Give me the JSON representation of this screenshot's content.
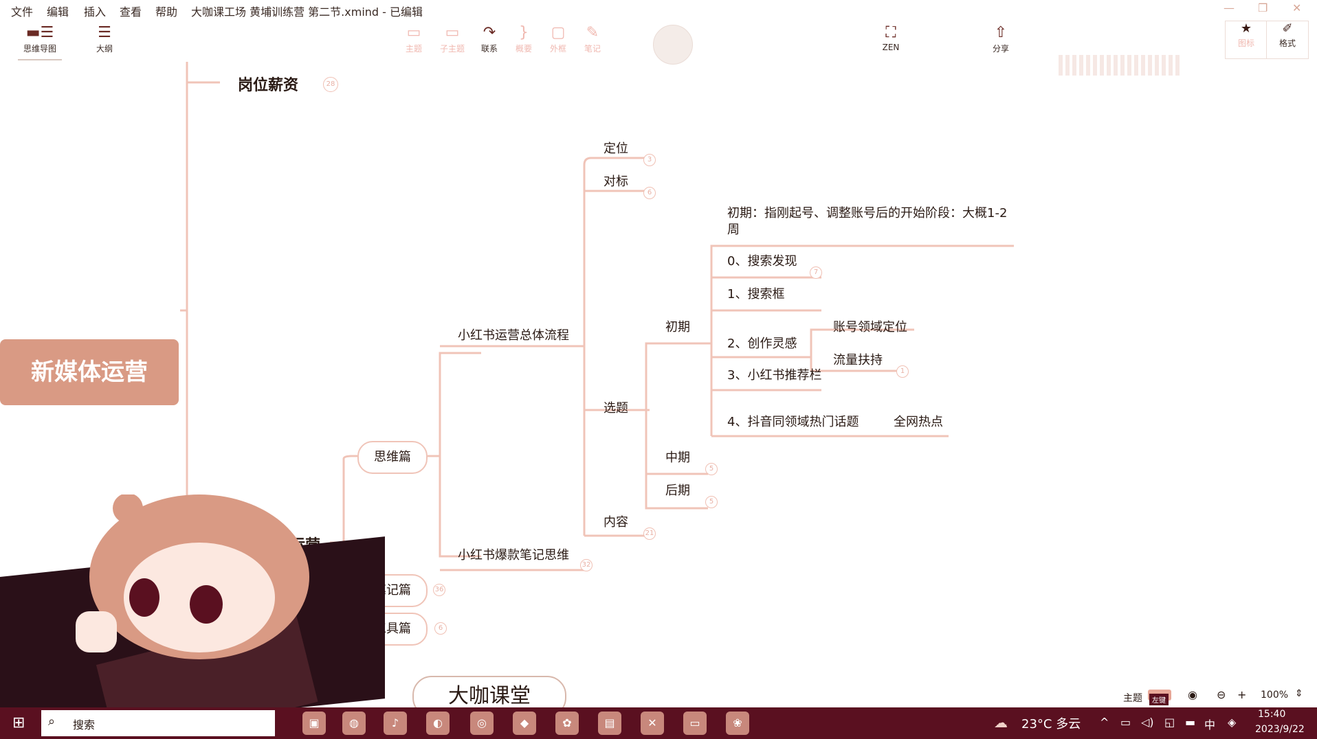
{
  "menubar": {
    "items": [
      "文件",
      "编辑",
      "插入",
      "查看",
      "帮助"
    ],
    "title": "大咖课工场 黄埔训练营 第二节.xmind - 已编辑"
  },
  "toolbar": {
    "mindmap": "思维导图",
    "outline": "大纲",
    "topic": "主题",
    "subtopic": "子主题",
    "relation": "联系",
    "summary": "概要",
    "boundary": "外框",
    "note": "笔记",
    "zen": "ZEN",
    "share": "分享",
    "icon_btn": "图标",
    "format": "格式"
  },
  "mindmap": {
    "root": "新媒体运营",
    "top_branch": "岗位薪资",
    "top_branch_count": "28",
    "partial_branch": "书运营",
    "l2": [
      {
        "label": "思维篇"
      },
      {
        "label": "笔记篇",
        "count": "36"
      },
      {
        "label": "工具篇",
        "count": "6"
      }
    ],
    "l3": [
      {
        "label": "小红书运营总体流程"
      },
      {
        "label": "小红书爆款笔记思维",
        "count": "32"
      }
    ],
    "l4": [
      {
        "label": "定位",
        "count": "3"
      },
      {
        "label": "对标",
        "count": "6"
      },
      {
        "label": "选题"
      },
      {
        "label": "内容",
        "count": "21"
      }
    ],
    "l5": [
      {
        "label": "初期"
      },
      {
        "label": "中期",
        "count": "5"
      },
      {
        "label": "后期",
        "count": "5"
      }
    ],
    "note_line1": "初期：指刚起号、调整账号后的开始阶段：大概1-2",
    "note_line2": "周",
    "l6": [
      {
        "label": "0、搜索发现",
        "count": "7"
      },
      {
        "label": "1、搜索框"
      },
      {
        "label": "2、创作灵感"
      },
      {
        "label": "3、小红书推荐栏"
      },
      {
        "label": "4、抖音同领域热门话题"
      }
    ],
    "l7": [
      {
        "label": "账号领域定位"
      },
      {
        "label": "流量扶持",
        "count": "1"
      },
      {
        "label": "全网热点"
      }
    ]
  },
  "status": {
    "theme": "主题",
    "zoom": "100%",
    "tag": "左键"
  },
  "overlay": {
    "logo": "大咖课堂"
  },
  "taskbar": {
    "search": "搜索",
    "weather": "23°C 多云",
    "ime": "中",
    "time": "15:40",
    "date": "2023/9/22"
  },
  "colors": {
    "root_fill": "#d99a84",
    "branch_line": "#f0c4b8",
    "taskbar": "#5a1020"
  }
}
